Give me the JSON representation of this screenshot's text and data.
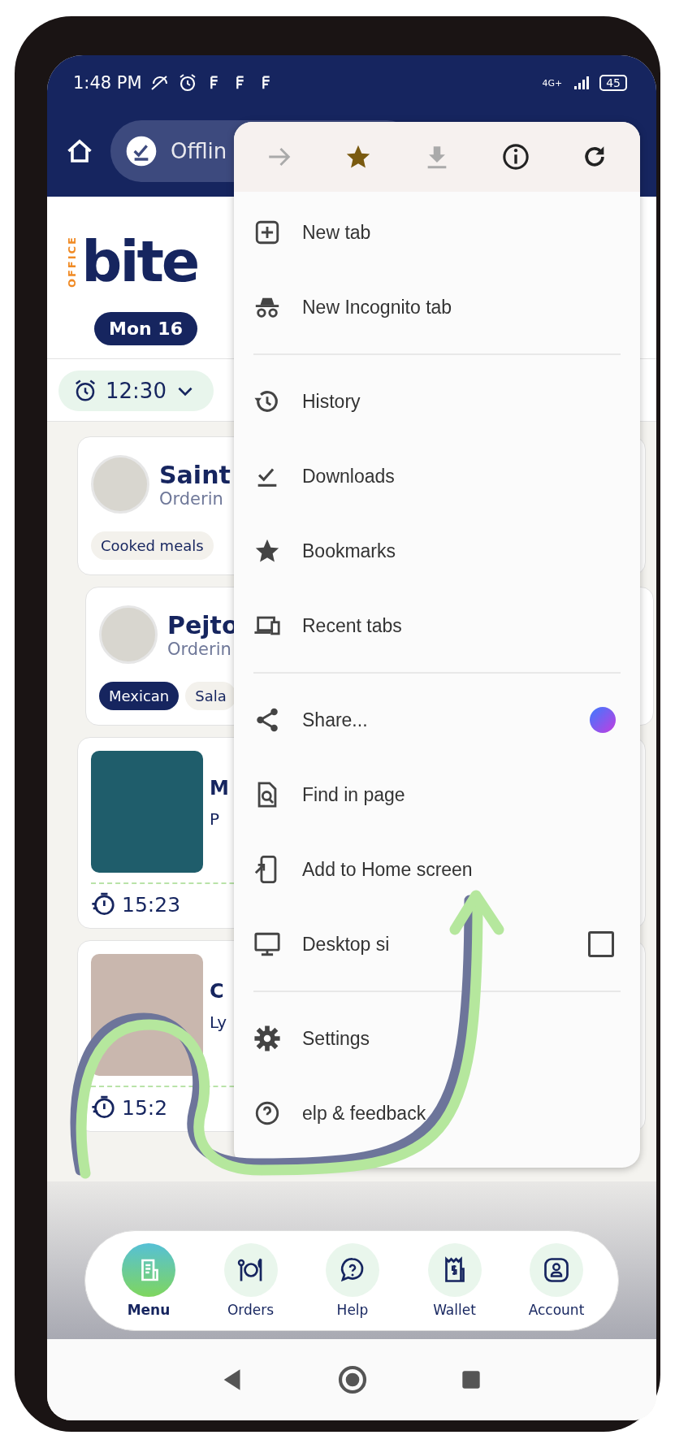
{
  "status_bar": {
    "time": "1:48 PM",
    "network": "4G+",
    "battery": "45"
  },
  "toolbar": {
    "address": "Offlin"
  },
  "logo": {
    "small": "OFFICE",
    "main": "bite"
  },
  "dates": [
    {
      "label": "Mon 16",
      "selected": true
    }
  ],
  "time_filter": {
    "value": "12:30"
  },
  "restaurants": [
    {
      "name": "Saint",
      "status": "Orderin",
      "tags": [
        {
          "label": "Cooked meals",
          "selected": false
        }
      ]
    },
    {
      "name": "Pejto",
      "status": "Orderin",
      "tags": [
        {
          "label": "Mexican",
          "selected": true
        },
        {
          "label": "Sala",
          "selected": false
        }
      ]
    }
  ],
  "meals": [
    {
      "title": "M",
      "line": "P",
      "time": "15:23"
    },
    {
      "title": "C",
      "line": "Ly",
      "time": "15:2"
    }
  ],
  "browser_menu": {
    "actions": [
      {
        "kind": "forward",
        "disabled": true
      },
      {
        "kind": "star",
        "disabled": false
      },
      {
        "kind": "download",
        "disabled": true
      },
      {
        "kind": "info",
        "disabled": false
      },
      {
        "kind": "reload",
        "disabled": false
      }
    ],
    "sections": [
      [
        {
          "kind": "plain",
          "label": "New tab"
        },
        {
          "kind": "plain",
          "label": "New Incognito tab"
        }
      ],
      [
        {
          "kind": "plain",
          "label": "History"
        },
        {
          "kind": "plain",
          "label": "Downloads"
        },
        {
          "kind": "plain",
          "label": "Bookmarks"
        },
        {
          "kind": "plain",
          "label": "Recent tabs"
        }
      ],
      [
        {
          "kind": "app",
          "label": "Share..."
        },
        {
          "kind": "plain",
          "label": "Find in page"
        },
        {
          "kind": "plain",
          "label": "Add to Home screen"
        },
        {
          "kind": "checkbox",
          "label": "Desktop si",
          "checked": false
        }
      ],
      [
        {
          "kind": "plain",
          "label": "Settings"
        },
        {
          "kind": "plain",
          "label": "elp & feedback"
        }
      ]
    ]
  },
  "bottom_nav": [
    {
      "label": "Menu",
      "selected": true
    },
    {
      "label": "Orders",
      "selected": false
    },
    {
      "label": "Help",
      "selected": false
    },
    {
      "label": "Wallet",
      "selected": false
    },
    {
      "label": "Account",
      "selected": false
    }
  ]
}
